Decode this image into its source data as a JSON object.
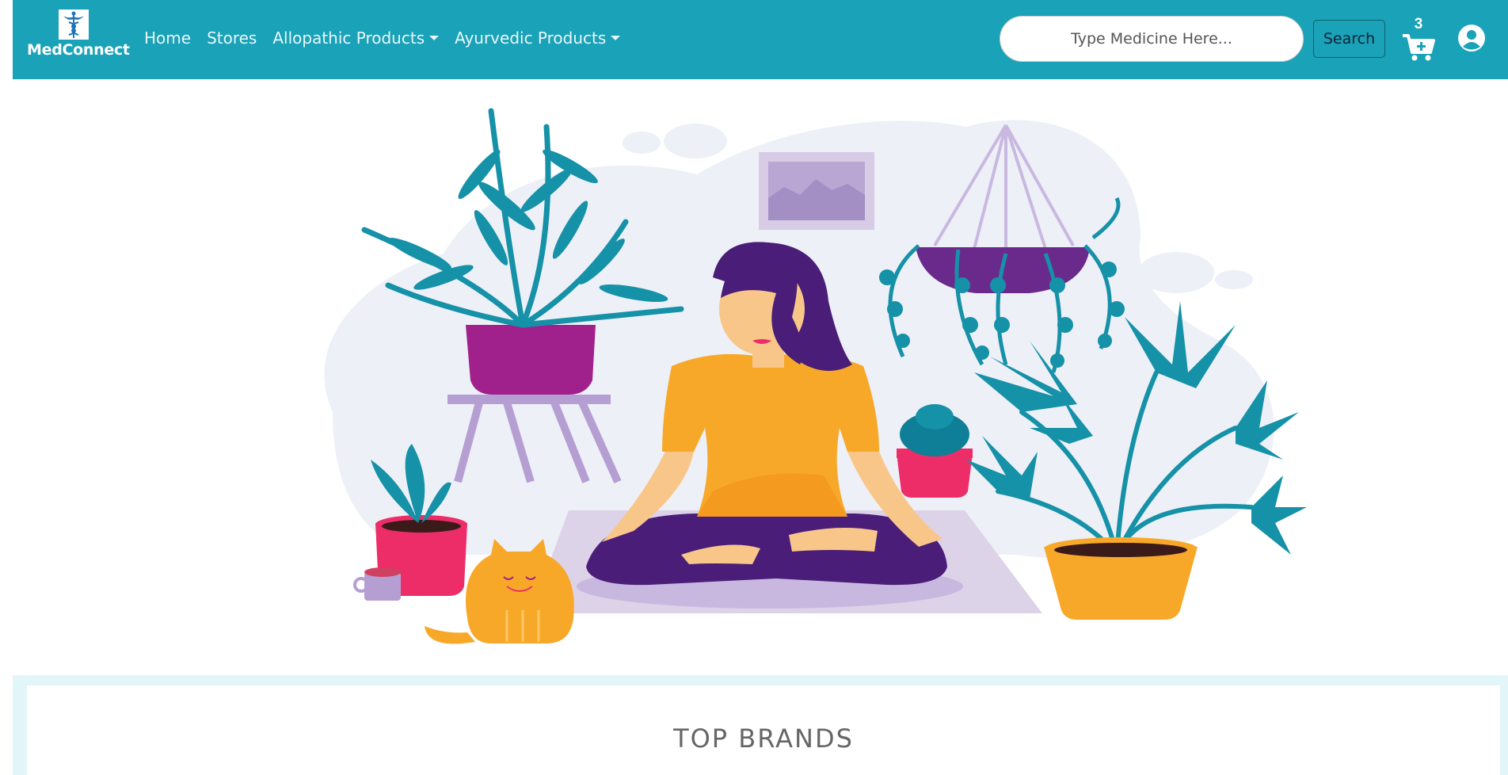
{
  "navbar": {
    "brand_name": "MedConnect",
    "links": [
      "Home",
      "Stores",
      "Allopathic Products",
      "Ayurvedic Products"
    ],
    "search_placeholder": "Type Medicine Here...",
    "search_button": "Search",
    "cart_count": "3",
    "colors": {
      "bar": "#19a2b8"
    }
  },
  "hero": {
    "illustration": "woman-meditating-with-plants-and-cat"
  },
  "brands": {
    "title": "TOP BRANDS"
  }
}
